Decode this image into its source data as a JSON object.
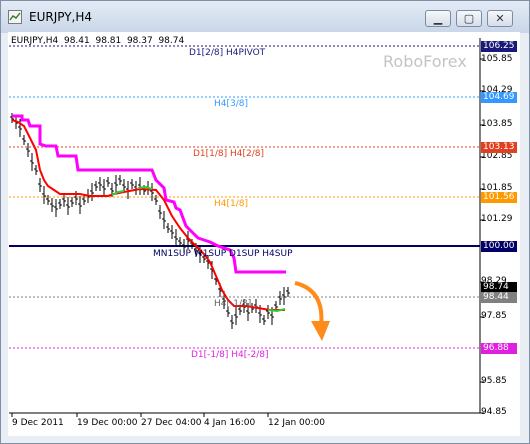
{
  "window": {
    "title": "EURJPY,H4",
    "controls": {
      "minimize": "▁",
      "maximize": "▢",
      "close": "✕"
    }
  },
  "chart": {
    "info_line": "EURJPY,H4  98.41  98.81  98.37  98.74",
    "watermark": "RoboForex",
    "levels": [
      {
        "label": "D1[2/8] H4PIVOT",
        "color": "#1a1a7a"
      },
      {
        "label": "H4[3/8]",
        "color": "#3399ff"
      },
      {
        "label": "D1[1/8] H4[2/8]",
        "color": "#e04020"
      },
      {
        "label": "H4[1/8]",
        "color": "#ff9900"
      },
      {
        "label": "MN1SUP W1SUP D1SUP H4SUP",
        "color": "#000066"
      },
      {
        "label": "H4[-1/8]",
        "color": "#808080"
      },
      {
        "label": "D1[-1/8] H4[-2/8]",
        "color": "#e020e0"
      }
    ],
    "price_scale": [
      "105.85",
      "104.29",
      "103.85",
      "102.85",
      "101.85",
      "101.29",
      "98.29",
      "97.85",
      "95.85",
      "94.85"
    ],
    "price_badges": [
      {
        "value": "106.25",
        "color": "#1a1a7a"
      },
      {
        "value": "104.69",
        "color": "#3399ff"
      },
      {
        "value": "103.13",
        "color": "#e04020"
      },
      {
        "value": "101.56",
        "color": "#ff9900"
      },
      {
        "value": "100.00",
        "color": "#000066"
      },
      {
        "value": "98.74",
        "color": "#000000"
      },
      {
        "value": "98.44",
        "color": "#808080"
      },
      {
        "value": "96.88",
        "color": "#e020e0"
      }
    ],
    "dates": [
      "9 Dec 2011",
      "19 Dec 00:00",
      "27 Dec 04:00",
      "4 Jan 16:00",
      "12 Jan 00:00"
    ],
    "colors": {
      "magenta_line": "#ff00ff",
      "red_line": "#ff0000",
      "green_line": "#33cc33",
      "arrow": "#ff8c1a"
    }
  }
}
